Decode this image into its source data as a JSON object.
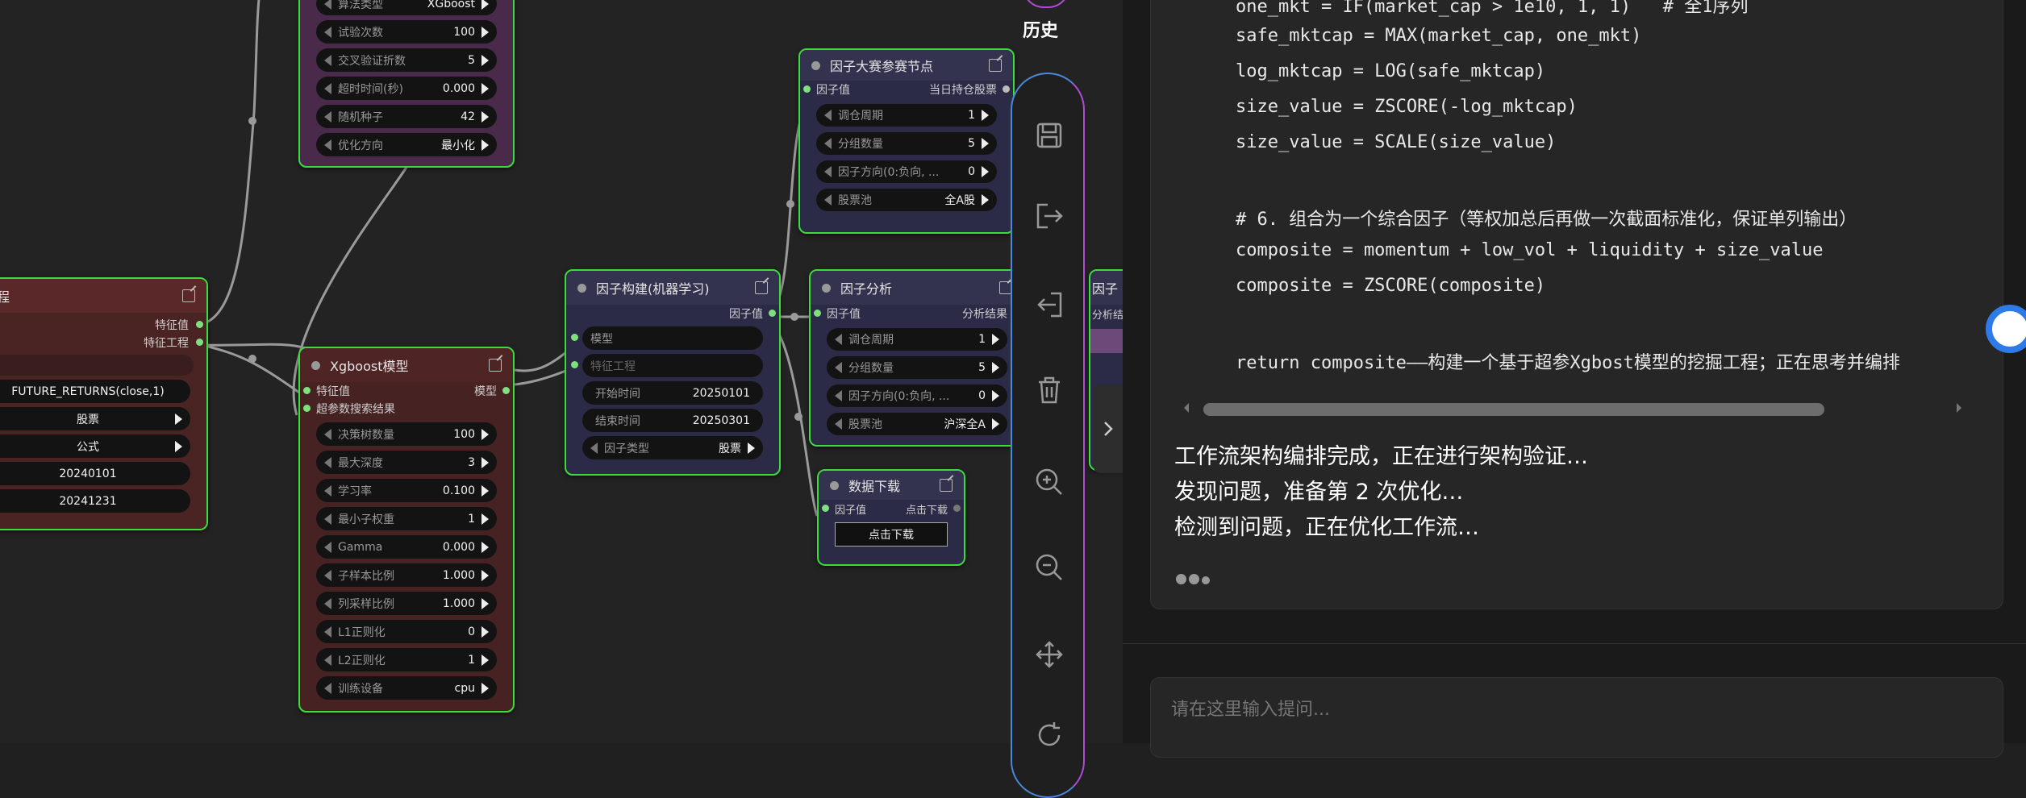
{
  "colors": {
    "node_border": "#3ddc3d",
    "accent_blue": "#4a88d8",
    "accent_purple": "#b24ad8"
  },
  "left_node": {
    "outputs": [
      "特征值",
      "特征工程"
    ],
    "widgets": [
      "FUTURE_RETURNS(close,1)",
      "股票",
      "公式",
      "20240101",
      "20241231"
    ]
  },
  "opt_node": {
    "top_label": "算法类型",
    "top_value": "XGboost",
    "rows": [
      {
        "label": "试验次数",
        "value": "100"
      },
      {
        "label": "交叉验证折数",
        "value": "5"
      },
      {
        "label": "超时时间(秒)",
        "value": "0.000"
      },
      {
        "label": "随机种子",
        "value": "42"
      },
      {
        "label": "优化方向",
        "value": "最小化"
      }
    ]
  },
  "xgb_node": {
    "title": "Xgboost模型",
    "inputs": [
      "特征值",
      "超参数搜索结果"
    ],
    "output": "模型",
    "rows": [
      {
        "label": "决策树数量",
        "value": "100"
      },
      {
        "label": "最大深度",
        "value": "3"
      },
      {
        "label": "学习率",
        "value": "0.100"
      },
      {
        "label": "最小子权重",
        "value": "1"
      },
      {
        "label": "Gamma",
        "value": "0.000"
      },
      {
        "label": "子样本比例",
        "value": "1.000"
      },
      {
        "label": "列采样比例",
        "value": "1.000"
      },
      {
        "label": "L1正则化",
        "value": "0"
      },
      {
        "label": "L2正则化",
        "value": "1"
      },
      {
        "label": "训练设备",
        "value": "cpu"
      }
    ]
  },
  "build_node": {
    "title": "因子构建(机器学习)",
    "output": "因子值",
    "inputs": [
      "模型",
      "特征工程"
    ],
    "rows": [
      {
        "label": "开始时间",
        "value": "20250101"
      },
      {
        "label": "结束时间",
        "value": "20250301"
      },
      {
        "label": "因子类型",
        "value": "股票"
      }
    ]
  },
  "contest_node": {
    "title": "因子大赛参赛节点",
    "input": "因子值",
    "output": "当日持仓股票",
    "rows": [
      {
        "label": "调仓周期",
        "value": "1"
      },
      {
        "label": "分组数量",
        "value": "5"
      },
      {
        "label": "因子方向(0:负向, ...",
        "value": "0"
      },
      {
        "label": "股票池",
        "value": "全A股"
      }
    ]
  },
  "analysis_node": {
    "title": "因子分析",
    "input": "因子值",
    "output": "分析结果",
    "rows": [
      {
        "label": "调仓周期",
        "value": "1"
      },
      {
        "label": "分组数量",
        "value": "5"
      },
      {
        "label": "因子方向(0:负向, ...",
        "value": "0"
      },
      {
        "label": "股票池",
        "value": "沪深全A"
      }
    ]
  },
  "download_node": {
    "title": "数据下载",
    "input": "因子值",
    "output": "点击下载",
    "button": "点击下载"
  },
  "partial_node": {
    "title": "因子",
    "sub": "分析结"
  },
  "toolbar": {
    "history_label": "历史",
    "icons": [
      "save-icon",
      "export-icon",
      "import-icon",
      "delete-icon",
      "zoom-in-icon",
      "zoom-out-icon",
      "move-icon",
      "refresh-icon"
    ]
  },
  "chat": {
    "code_lines": [
      "one_mkt = IF(market_cap > 1e10, 1, 1)   # 全1序列",
      "safe_mktcap = MAX(market_cap, one_mkt)",
      "log_mktcap = LOG(safe_mktcap)",
      "size_value = ZSCORE(-log_mktcap)",
      "size_value = SCALE(size_value)",
      "",
      "# 6. 组合为一个综合因子（等权加总后再做一次截面标准化，保证单列输出）",
      "composite = momentum + low_vol + liquidity + size_value",
      "composite = ZSCORE(composite)",
      "",
      "return composite——构建一个基于超参Xgbost模型的挖掘工程；正在思考并编排"
    ],
    "status": [
      "工作流架构编排完成，正在进行架构验证…",
      "发现问题，准备第 2 次优化…",
      "检测到问题，正在优化工作流…"
    ],
    "placeholder": "请在这里输入提问..."
  }
}
